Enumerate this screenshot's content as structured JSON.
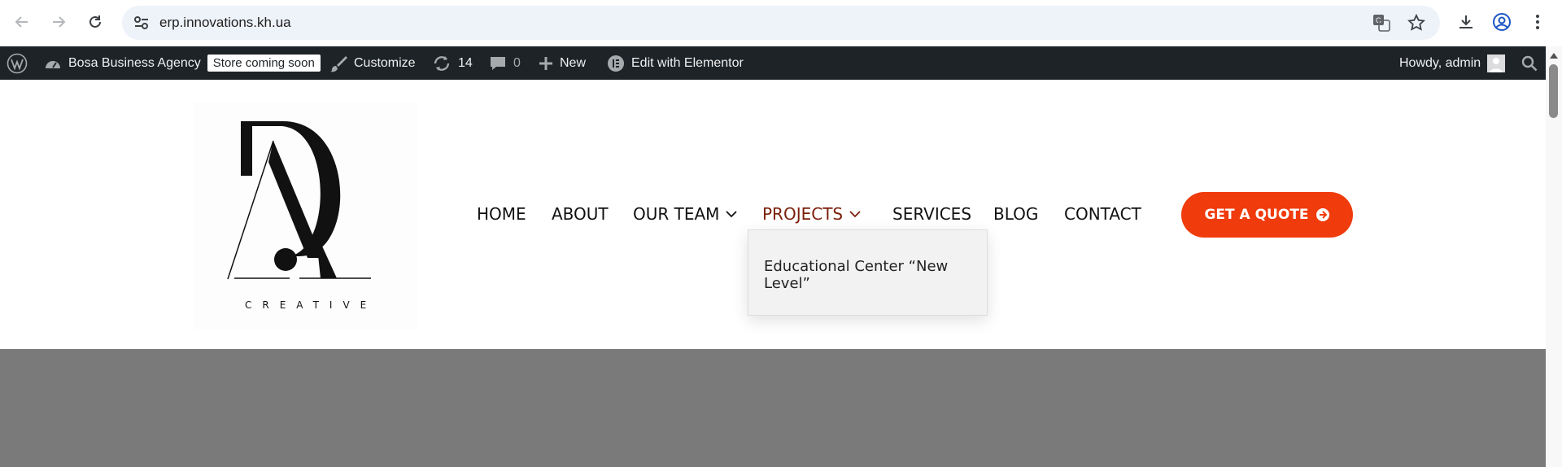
{
  "browser": {
    "url": "erp.innovations.kh.ua"
  },
  "wp_admin_bar": {
    "site_name": "Bosa Business Agency",
    "store_badge": "Store coming soon",
    "customize": "Customize",
    "updates_count": "14",
    "comments_count": "0",
    "new_label": "New",
    "elementor_label": "Edit with Elementor",
    "howdy": "Howdy, admin"
  },
  "logo": {
    "text": "CREATIVE"
  },
  "nav": {
    "items": [
      {
        "label": "HOME"
      },
      {
        "label": "ABOUT"
      },
      {
        "label": "OUR TEAM"
      },
      {
        "label": "PROJECTS"
      },
      {
        "label": "SERVICES"
      },
      {
        "label": "BLOG"
      },
      {
        "label": "CONTACT"
      }
    ],
    "active_color": "#7a1f0b",
    "cta_label": "GET A QUOTE",
    "cta_color": "#f03b0c"
  },
  "projects_dropdown": {
    "items": [
      "Educational Center “New Level”"
    ]
  },
  "hero": {
    "color": "#7a7a7a"
  }
}
